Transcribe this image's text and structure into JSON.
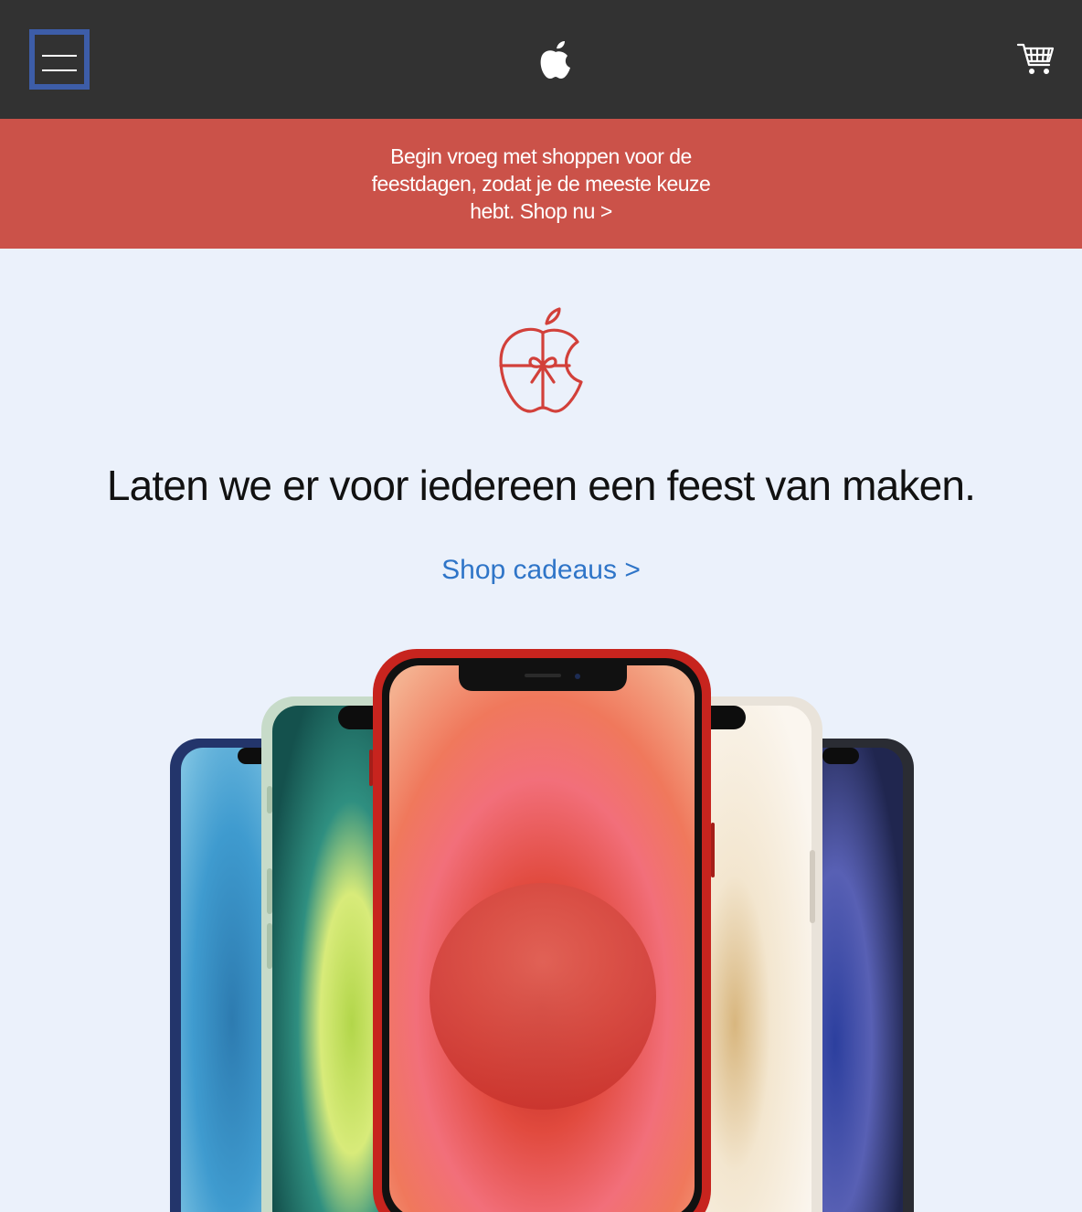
{
  "nav": {
    "menu_icon": "hamburger-menu-icon",
    "logo_icon": "apple-logo-icon",
    "cart_icon": "shopping-cart-icon"
  },
  "promo": {
    "text": "Begin vroeg met shoppen voor de feestdagen, zodat je de meeste keuze hebt. Shop nu >",
    "background": "#cb5249"
  },
  "hero": {
    "gift_icon": "apple-gift-bow-icon",
    "headline": "Laten we er voor iedereen een feest van maken.",
    "cta": "Shop cadeaus >",
    "image": "iphone-12-lineup-image",
    "link_color": "#2f75c8"
  },
  "colors": {
    "nav_bg": "#323232",
    "page_bg": "#ebf1fb",
    "focus_ring": "#3d5da8"
  }
}
